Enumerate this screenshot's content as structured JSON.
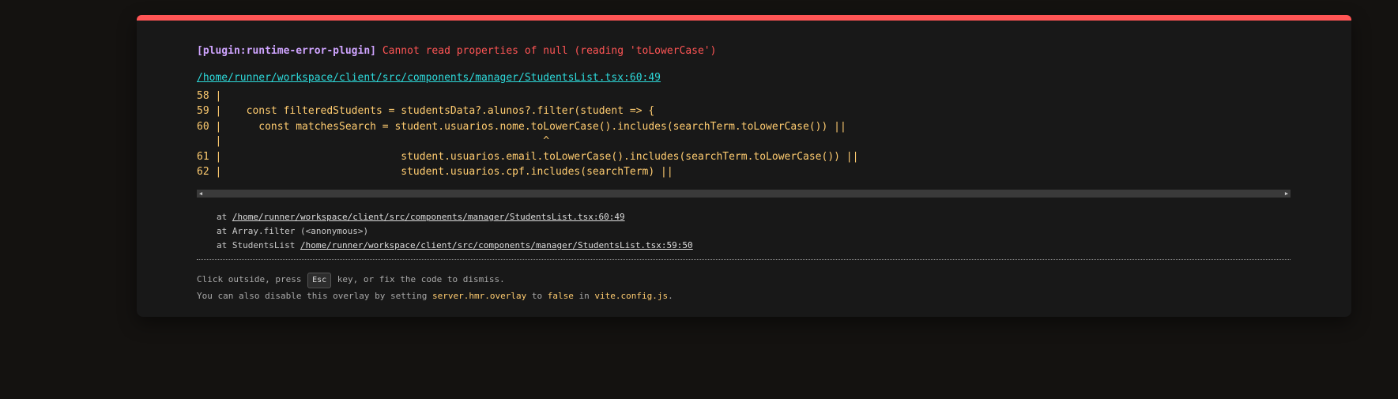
{
  "error": {
    "plugin": "[plugin:runtime-error-plugin]",
    "message": "Cannot read properties of null (reading 'toLowerCase')",
    "file": "/home/runner/workspace/client/src/components/manager/StudentsList.tsx:60:49"
  },
  "frame": {
    "lines": [
      "58 |",
      "59 |    const filteredStudents = studentsData?.alunos?.filter(student => {",
      "60 |      const matchesSearch = student.usuarios.nome.toLowerCase().includes(searchTerm.toLowerCase()) ||",
      "   |                                                    ^",
      "61 |                             student.usuarios.email.toLowerCase().includes(searchTerm.toLowerCase()) ||",
      "62 |                             student.usuarios.cpf.includes(searchTerm) ||"
    ]
  },
  "stack": [
    {
      "prefix": "at ",
      "text": "",
      "link": "/home/runner/workspace/client/src/components/manager/StudentsList.tsx:60:49"
    },
    {
      "prefix": "at ",
      "text": "Array.filter (<anonymous>)",
      "link": ""
    },
    {
      "prefix": "at ",
      "text": "StudentsList ",
      "link": "/home/runner/workspace/client/src/components/manager/StudentsList.tsx:59:50"
    }
  ],
  "tip": {
    "line1_before": "Click outside, press ",
    "key": "Esc",
    "line1_after": " key, or fix the code to dismiss.",
    "line2_a": "You can also disable this overlay by setting ",
    "line2_code1": "server.hmr.overlay",
    "line2_b": " to ",
    "line2_code2": "false",
    "line2_c": " in ",
    "line2_code3": "vite.config.js",
    "line2_d": "."
  },
  "colors": {
    "accent": "#ff5555",
    "plugin": "#cfa4ff",
    "file_link": "#2dd9da",
    "code": "#ffcc70"
  },
  "icons": {
    "scroll_left": "triangle-left-icon",
    "scroll_right": "triangle-right-icon"
  }
}
